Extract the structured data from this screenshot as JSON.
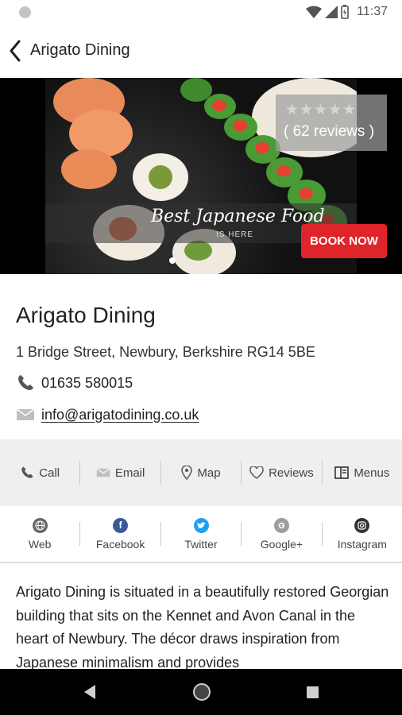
{
  "status_bar": {
    "time": "11:37"
  },
  "app_bar": {
    "title": "Arigato Dining"
  },
  "hero": {
    "reviews": "( 62 reviews )",
    "rating_stars": 0,
    "tagline": "Best Japanese Food",
    "tagline_sub": "IS HERE",
    "book_button": "BOOK NOW",
    "slide_index": 1
  },
  "info": {
    "name": "Arigato Dining",
    "address": "1 Bridge Street, Newbury, Berkshire RG14 5BE",
    "phone": "01635 580015",
    "email": "info@arigatodining.co.uk"
  },
  "actions": [
    {
      "label": "Call",
      "icon": "phone-icon"
    },
    {
      "label": "Email",
      "icon": "envelope-icon"
    },
    {
      "label": "Map",
      "icon": "map-pin-icon"
    },
    {
      "label": "Reviews",
      "icon": "heart-icon"
    },
    {
      "label": "Menus",
      "icon": "menu-book-icon"
    }
  ],
  "social": [
    {
      "label": "Web",
      "icon": "globe-icon",
      "color": "#666666"
    },
    {
      "label": "Facebook",
      "icon": "facebook-icon",
      "color": "#3b5998"
    },
    {
      "label": "Twitter",
      "icon": "twitter-icon",
      "color": "#1da1f2"
    },
    {
      "label": "Google+",
      "icon": "google-plus-icon",
      "color": "#9e9e9e"
    },
    {
      "label": "Instagram",
      "icon": "instagram-icon",
      "color": "#333333"
    }
  ],
  "description": "Arigato Dining is situated in a beautifully restored Georgian building that sits on the Kennet and Avon Canal in the heart of Newbury. The décor draws inspiration from Japanese minimalism and provides",
  "colors": {
    "accent_red": "#e0242b",
    "action_bar_bg": "#efefef"
  }
}
